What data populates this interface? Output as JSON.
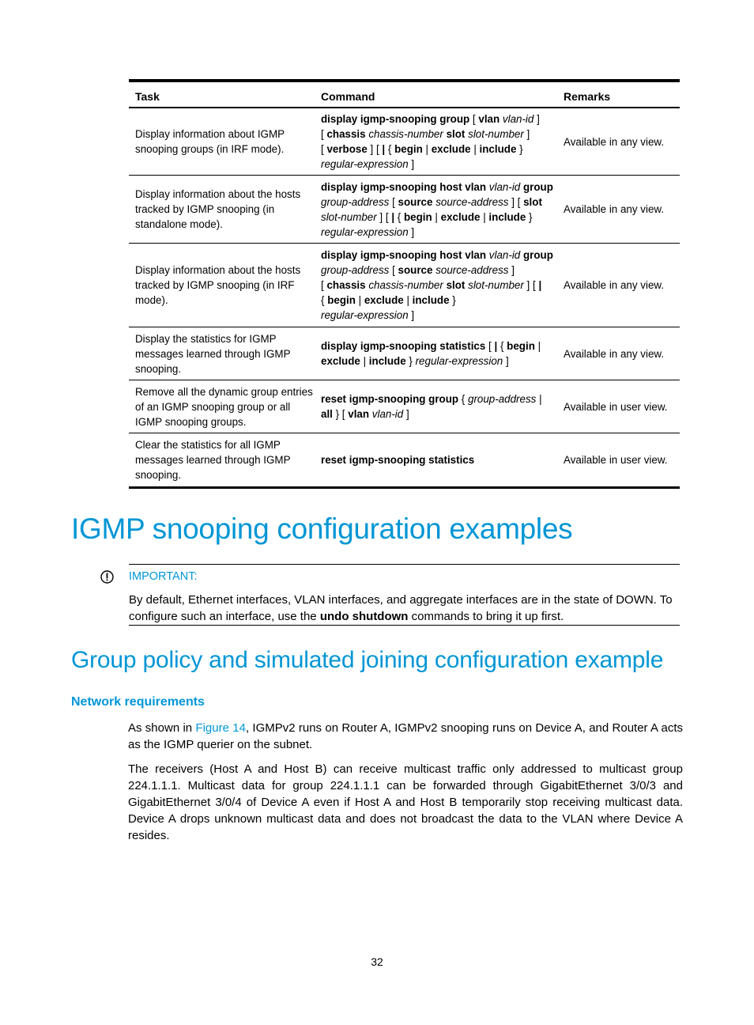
{
  "table": {
    "headers": {
      "task": "Task",
      "command": "Command",
      "remarks": "Remarks"
    },
    "rows": [
      {
        "task": "Display information about IGMP snooping groups (in IRF mode).",
        "command": [
          [
            [
              "b",
              "display igmp-snooping group"
            ],
            [
              "t",
              " [ "
            ],
            [
              "b",
              "vlan"
            ],
            [
              "t",
              " "
            ],
            [
              "i",
              "vlan-id"
            ],
            [
              "t",
              " ]"
            ]
          ],
          [
            [
              "t",
              "[ "
            ],
            [
              "b",
              "chassis"
            ],
            [
              "t",
              " "
            ],
            [
              "i",
              "chassis-number"
            ],
            [
              "t",
              " "
            ],
            [
              "b",
              "slot"
            ],
            [
              "t",
              " "
            ],
            [
              "i",
              "slot-number"
            ],
            [
              "t",
              " ]"
            ]
          ],
          [
            [
              "t",
              "[ "
            ],
            [
              "b",
              "verbose"
            ],
            [
              "t",
              " ] [ "
            ],
            [
              "b",
              "|"
            ],
            [
              "t",
              " { "
            ],
            [
              "b",
              "begin"
            ],
            [
              "t",
              " | "
            ],
            [
              "b",
              "exclude"
            ],
            [
              "t",
              " | "
            ],
            [
              "b",
              "include"
            ],
            [
              "t",
              " }"
            ]
          ],
          [
            [
              "i",
              "regular-expression"
            ],
            [
              "t",
              " ]"
            ]
          ]
        ],
        "remarks": "Available in any view."
      },
      {
        "task": "Display information about the hosts tracked by IGMP snooping (in standalone mode).",
        "command": [
          [
            [
              "b",
              "display igmp-snooping host vlan"
            ],
            [
              "t",
              " "
            ],
            [
              "i",
              "vlan-id"
            ],
            [
              "t",
              " "
            ],
            [
              "b",
              "group"
            ]
          ],
          [
            [
              "i",
              "group-address"
            ],
            [
              "t",
              " [ "
            ],
            [
              "b",
              "source"
            ],
            [
              "t",
              " "
            ],
            [
              "i",
              "source-address"
            ],
            [
              "t",
              " ] [ "
            ],
            [
              "b",
              "slot"
            ]
          ],
          [
            [
              "i",
              "slot-number"
            ],
            [
              "t",
              " ] [ "
            ],
            [
              "b",
              "|"
            ],
            [
              "t",
              " { "
            ],
            [
              "b",
              "begin"
            ],
            [
              "t",
              " | "
            ],
            [
              "b",
              "exclude"
            ],
            [
              "t",
              " | "
            ],
            [
              "b",
              "include"
            ],
            [
              "t",
              " }"
            ]
          ],
          [
            [
              "i",
              "regular-expression"
            ],
            [
              "t",
              " ]"
            ]
          ]
        ],
        "remarks": "Available in any view."
      },
      {
        "task": "Display information about the hosts tracked by IGMP snooping (in IRF mode).",
        "command": [
          [
            [
              "b",
              "display igmp-snooping host vlan"
            ],
            [
              "t",
              " "
            ],
            [
              "i",
              "vlan-id"
            ],
            [
              "t",
              " "
            ],
            [
              "b",
              "group"
            ]
          ],
          [
            [
              "i",
              "group-address"
            ],
            [
              "t",
              " [ "
            ],
            [
              "b",
              "source"
            ],
            [
              "t",
              " "
            ],
            [
              "i",
              "source-address"
            ],
            [
              "t",
              " ]"
            ]
          ],
          [
            [
              "t",
              "[ "
            ],
            [
              "b",
              "chassis"
            ],
            [
              "t",
              " "
            ],
            [
              "i",
              "chassis-number"
            ],
            [
              "t",
              " "
            ],
            [
              "b",
              "slot"
            ],
            [
              "t",
              " "
            ],
            [
              "i",
              "slot-number"
            ],
            [
              "t",
              " ] [ "
            ],
            [
              "b",
              "|"
            ]
          ],
          [
            [
              "t",
              "{ "
            ],
            [
              "b",
              "begin"
            ],
            [
              "t",
              " | "
            ],
            [
              "b",
              "exclude"
            ],
            [
              "t",
              " | "
            ],
            [
              "b",
              "include"
            ],
            [
              "t",
              " }"
            ]
          ],
          [
            [
              "i",
              "regular-expression"
            ],
            [
              "t",
              " ]"
            ]
          ]
        ],
        "remarks": "Available in any view."
      },
      {
        "task": "Display the statistics for IGMP messages learned through IGMP snooping.",
        "command": [
          [
            [
              "b",
              "display igmp-snooping statistics"
            ],
            [
              "t",
              " [ "
            ],
            [
              "b",
              "|"
            ],
            [
              "t",
              " { "
            ],
            [
              "b",
              "begin"
            ],
            [
              "t",
              " |"
            ]
          ],
          [
            [
              "b",
              "exclude"
            ],
            [
              "t",
              " | "
            ],
            [
              "b",
              "include"
            ],
            [
              "t",
              " } "
            ],
            [
              "i",
              "regular-expression"
            ],
            [
              "t",
              " ]"
            ]
          ]
        ],
        "remarks": "Available in any view."
      },
      {
        "task": "Remove all the dynamic group entries of an IGMP snooping group or all IGMP snooping groups.",
        "command": [
          [
            [
              "b",
              "reset igmp-snooping group"
            ],
            [
              "t",
              " { "
            ],
            [
              "i",
              "group-address"
            ],
            [
              "t",
              " |"
            ]
          ],
          [
            [
              "b",
              "all"
            ],
            [
              "t",
              " } [ "
            ],
            [
              "b",
              "vlan"
            ],
            [
              "t",
              " "
            ],
            [
              "i",
              "vlan-id"
            ],
            [
              "t",
              " ]"
            ]
          ]
        ],
        "remarks": "Available in user view."
      },
      {
        "task": "Clear the statistics for all IGMP messages learned through IGMP snooping.",
        "command": [
          [
            [
              "b",
              "reset igmp-snooping statistics"
            ]
          ]
        ],
        "remarks": "Available in user view."
      }
    ]
  },
  "section_title": "IGMP snooping configuration examples",
  "important": {
    "icon": "exclamation-circle-icon",
    "label": "IMPORTANT:",
    "text_before": "By default, Ethernet interfaces, VLAN interfaces, and aggregate interfaces are in the state of DOWN. To configure such an interface, use the ",
    "text_bold": "undo shutdown",
    "text_after": " commands to bring it up first."
  },
  "subsection_title": "Group policy and simulated joining configuration example",
  "subsubsection_title": "Network requirements",
  "paragraphs": {
    "p1_before": "As shown in ",
    "p1_link": "Figure 14",
    "p1_after": ", IGMPv2 runs on Router A, IGMPv2 snooping runs on Device A, and Router A acts as the IGMP querier on the subnet.",
    "p2": "The receivers (Host A and Host B) can receive multicast traffic only addressed to multicast group 224.1.1.1. Multicast data for group 224.1.1.1 can be forwarded through GigabitEthernet 3/0/3 and GigabitEthernet 3/0/4 of Device A even if Host A and Host B temporarily stop receiving multicast data. Device A drops unknown multicast data and does not broadcast the data to the VLAN where Device A resides."
  },
  "page_number": "32"
}
